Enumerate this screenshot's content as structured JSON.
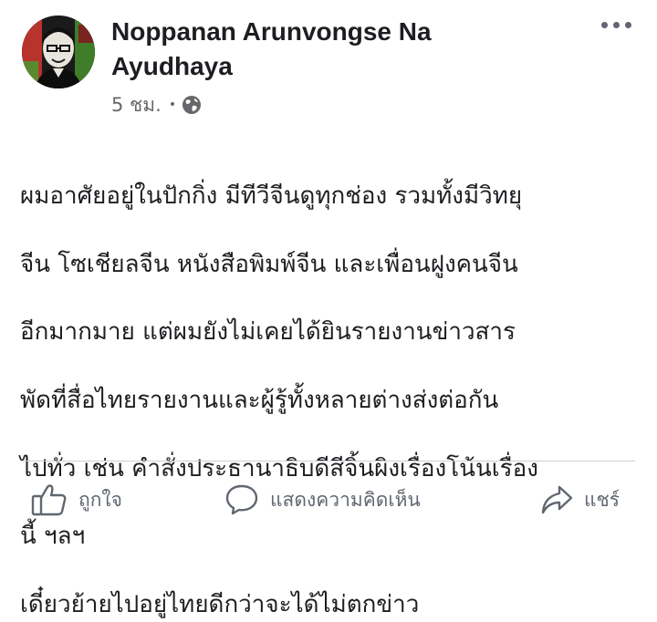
{
  "author": {
    "name_line1": "Noppanan Arunvongse Na",
    "name_line2": "Ayudhaya"
  },
  "meta": {
    "time": "5 ชม.",
    "separator": "•",
    "privacy_icon": "globe-icon"
  },
  "more_icon": "more-dots-icon",
  "post": {
    "paragraph1_lines": [
      "ผมอาศัยอยู่ในปักกิ่ง มีทีวีจีนดูทุกช่อง รวมทั้งมีวิทยุ",
      "จีน โซเชียลจีน หนังสือพิมพ์จีน และเพื่อนฝูงคนจีน",
      "อีกมากมาย แต่ผมยังไม่เคยได้ยินรายงานข่าวสาร",
      "พัดที่สื่อไทยรายงานและผู้รู้ทั้งหลายต่างส่งต่อกัน",
      "ไปทั่ว เช่น คำสั่งประธานาธิบดีสีจิ้นผิงเรื่องโน้นเรื่อง",
      "นี้ ฯลฯ"
    ],
    "paragraph2": "เดี๋ยวย้ายไปอยู่ไทยดีกว่าจะได้ไม่ตกข่าว"
  },
  "actions": {
    "like_label": "ถูกใจ",
    "comment_label": "แสดงความคิดเห็น",
    "share_label": "แชร์"
  },
  "colors": {
    "text": "#1c1e21",
    "secondary": "#65676b",
    "action": "#606770",
    "divider": "#ced0d4"
  }
}
